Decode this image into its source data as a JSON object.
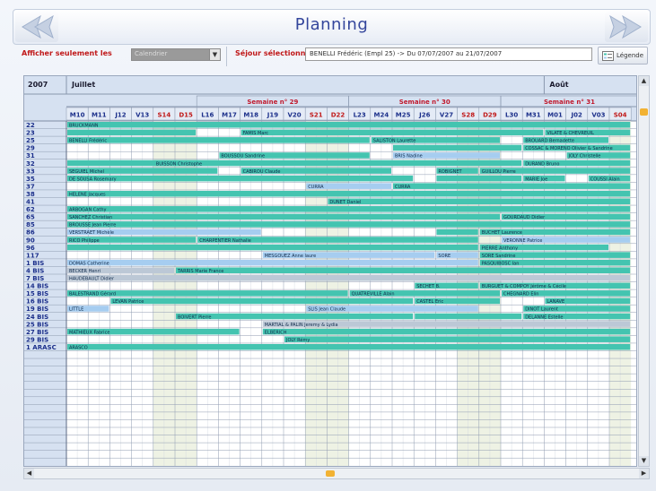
{
  "header": {
    "title": "Planning"
  },
  "filter": {
    "label": "Afficher seulement les",
    "value": "Calendrier"
  },
  "sejour": {
    "label": "Séjour sélectionné",
    "value": "BENELLI Frédéric (Empl 25) -> Du 07/07/2007 au 21/07/2007"
  },
  "legend_label": "Légende",
  "colors": {
    "teal": "#44c4b0",
    "blue": "#a6cdf0",
    "grey": "#bcc8d6",
    "header_bg": "#d6e1f1",
    "week_red": "#c0182c",
    "day_blue": "#1b2f8a",
    "weekend_red": "#c01818"
  },
  "planning": {
    "year": "2007",
    "months": [
      "Juillet",
      "Août"
    ],
    "weeks": [
      "Semaine n° 29",
      "Semaine n° 30",
      "Semaine n° 31"
    ],
    "days": [
      {
        "label": "M10",
        "weekend": false
      },
      {
        "label": "M11",
        "weekend": false
      },
      {
        "label": "J12",
        "weekend": false
      },
      {
        "label": "V13",
        "weekend": false
      },
      {
        "label": "S14",
        "weekend": true
      },
      {
        "label": "D15",
        "weekend": true
      },
      {
        "label": "L16",
        "weekend": false
      },
      {
        "label": "M17",
        "weekend": false
      },
      {
        "label": "M18",
        "weekend": false
      },
      {
        "label": "J19",
        "weekend": false
      },
      {
        "label": "V20",
        "weekend": false
      },
      {
        "label": "S21",
        "weekend": true
      },
      {
        "label": "D22",
        "weekend": true
      },
      {
        "label": "L23",
        "weekend": false
      },
      {
        "label": "M24",
        "weekend": false
      },
      {
        "label": "M25",
        "weekend": false
      },
      {
        "label": "J26",
        "weekend": false
      },
      {
        "label": "V27",
        "weekend": false
      },
      {
        "label": "S28",
        "weekend": true
      },
      {
        "label": "D29",
        "weekend": true
      },
      {
        "label": "L30",
        "weekend": false
      },
      {
        "label": "M31",
        "weekend": false
      },
      {
        "label": "M01",
        "weekend": false
      },
      {
        "label": "J02",
        "weekend": false
      },
      {
        "label": "V03",
        "weekend": false
      },
      {
        "label": "S04",
        "weekend": true
      }
    ],
    "rows": [
      {
        "label": "22",
        "bars": [
          {
            "s": 0,
            "e": 26,
            "c": "teal",
            "t": "BRUCKMANN"
          }
        ]
      },
      {
        "label": "23",
        "bars": [
          {
            "s": 0,
            "e": 6,
            "c": "teal",
            "t": ""
          },
          {
            "s": 8,
            "e": 22,
            "c": "teal",
            "t": "FAMIS Marc"
          },
          {
            "s": 22,
            "e": 26,
            "c": "teal",
            "t": "VILATE & CHEVREUIL"
          }
        ]
      },
      {
        "label": "25",
        "bars": [
          {
            "s": 0,
            "e": 14,
            "c": "teal",
            "t": "BENELLI Frédéric"
          },
          {
            "s": 14,
            "e": 20,
            "c": "teal",
            "t": "SALISTON Laurette"
          },
          {
            "s": 21,
            "e": 25,
            "c": "teal",
            "t": "BROUARD Bernadette"
          }
        ]
      },
      {
        "label": "29",
        "bars": [
          {
            "s": 15,
            "e": 21,
            "c": "teal",
            "t": ""
          },
          {
            "s": 21,
            "e": 26,
            "c": "teal",
            "t": "COSSAC & MORENO Olivier & Sandrine"
          }
        ]
      },
      {
        "label": "31",
        "bars": [
          {
            "s": 7,
            "e": 14,
            "c": "teal",
            "t": "BOUSSOU Sandrine"
          },
          {
            "s": 15,
            "e": 20,
            "c": "blue",
            "t": "BRIS Nadine"
          },
          {
            "s": 23,
            "e": 26,
            "c": "teal",
            "t": "JOLY Christelle"
          }
        ]
      },
      {
        "label": "32",
        "bars": [
          {
            "s": 0,
            "e": 7,
            "c": "teal",
            "t": ""
          },
          {
            "s": 4,
            "e": 21,
            "c": "teal",
            "t": "BUISSON Christophe"
          },
          {
            "s": 21,
            "e": 26,
            "c": "teal",
            "t": "DURAND Bruno"
          }
        ]
      },
      {
        "label": "33",
        "bars": [
          {
            "s": 0,
            "e": 7,
            "c": "teal",
            "t": "SEGUIEL Michel"
          },
          {
            "s": 8,
            "e": 15,
            "c": "teal",
            "t": "CABIROU Claude"
          },
          {
            "s": 17,
            "e": 19,
            "c": "teal",
            "t": "ROBIGNET"
          },
          {
            "s": 19,
            "e": 26,
            "c": "teal",
            "t": "GUILLOU Pierre"
          }
        ]
      },
      {
        "label": "35",
        "bars": [
          {
            "s": 0,
            "e": 16,
            "c": "teal",
            "t": "DE SOUSA Rosemary"
          },
          {
            "s": 17,
            "e": 21,
            "c": "teal",
            "t": ""
          },
          {
            "s": 21,
            "e": 23,
            "c": "teal",
            "t": "MARIE Joe"
          },
          {
            "s": 24,
            "e": 26,
            "c": "teal",
            "t": "COUSSI Alain"
          }
        ]
      },
      {
        "label": "37",
        "bars": [
          {
            "s": 11,
            "e": 15,
            "c": "blue",
            "t": "CURRA"
          },
          {
            "s": 15,
            "e": 26,
            "c": "teal",
            "t": "CURRA"
          }
        ]
      },
      {
        "label": "38",
        "bars": [
          {
            "s": 0,
            "e": 26,
            "c": "teal",
            "t": "HELENE Jacques"
          }
        ]
      },
      {
        "label": "41",
        "bars": [
          {
            "s": 12,
            "e": 26,
            "c": "teal",
            "t": "DUNET Daniel"
          }
        ]
      },
      {
        "label": "62",
        "bars": [
          {
            "s": 0,
            "e": 26,
            "c": "teal",
            "t": "ARBOGAN Cathy"
          }
        ]
      },
      {
        "label": "65",
        "bars": [
          {
            "s": 0,
            "e": 20,
            "c": "teal",
            "t": "SANCHEZ Christian"
          },
          {
            "s": 20,
            "e": 26,
            "c": "teal",
            "t": "GOURDAUD Didier"
          }
        ]
      },
      {
        "label": "85",
        "bars": [
          {
            "s": 0,
            "e": 26,
            "c": "teal",
            "t": "BROUSSE Jean Pierre"
          }
        ]
      },
      {
        "label": "86",
        "bars": [
          {
            "s": 0,
            "e": 9,
            "c": "blue",
            "t": "VERSTRAET Michèle"
          },
          {
            "s": 17,
            "e": 19,
            "c": "teal",
            "t": ""
          },
          {
            "s": 19,
            "e": 26,
            "c": "teal",
            "t": "BUCHET Laurence"
          }
        ]
      },
      {
        "label": "90",
        "bars": [
          {
            "s": 0,
            "e": 6,
            "c": "teal",
            "t": "RICO Philippe"
          },
          {
            "s": 6,
            "e": 19,
            "c": "teal",
            "t": "CHARPENTIER Nathalie"
          },
          {
            "s": 20,
            "e": 26,
            "c": "blue",
            "t": "VERONNE Patrice"
          }
        ]
      },
      {
        "label": "96",
        "bars": [
          {
            "s": 0,
            "e": 19,
            "c": "teal",
            "t": ""
          },
          {
            "s": 19,
            "e": 25,
            "c": "teal",
            "t": "PIERRE Anthony"
          }
        ]
      },
      {
        "label": "117",
        "bars": [
          {
            "s": 9,
            "e": 17,
            "c": "blue",
            "t": "MESGOUEZ Anne laure"
          },
          {
            "s": 17,
            "e": 19,
            "c": "blue",
            "t": "SORE"
          },
          {
            "s": 19,
            "e": 26,
            "c": "teal",
            "t": "SORE Sandrine"
          }
        ]
      },
      {
        "label": "1 BIS",
        "bars": [
          {
            "s": 0,
            "e": 19,
            "c": "blue",
            "t": "DOMAS Catherine"
          },
          {
            "s": 19,
            "e": 26,
            "c": "teal",
            "t": "PASQUIBOSC Ian"
          }
        ]
      },
      {
        "label": "4 BIS",
        "bars": [
          {
            "s": 0,
            "e": 5,
            "c": "grey",
            "t": "BECKER Henri"
          },
          {
            "s": 5,
            "e": 26,
            "c": "teal",
            "t": "TARRIS Marie France"
          }
        ]
      },
      {
        "label": "7 BIS",
        "bars": [
          {
            "s": 0,
            "e": 26,
            "c": "grey",
            "t": "HAUDEBAULT Didier"
          }
        ]
      },
      {
        "label": "14 BIS",
        "bars": [
          {
            "s": 16,
            "e": 19,
            "c": "teal",
            "t": "SECHET B."
          },
          {
            "s": 19,
            "e": 26,
            "c": "teal",
            "t": "BURGUET & COMPOY Jérôme & Cécile"
          }
        ]
      },
      {
        "label": "15 BIS",
        "bars": [
          {
            "s": 0,
            "e": 13,
            "c": "teal",
            "t": "BALESTRAND Gérard"
          },
          {
            "s": 13,
            "e": 20,
            "c": "teal",
            "t": "QUATREVILLE Alain"
          },
          {
            "s": 20,
            "e": 26,
            "c": "teal",
            "t": "CHEGNARD Elin"
          }
        ]
      },
      {
        "label": "16 BIS",
        "bars": [
          {
            "s": 2,
            "e": 16,
            "c": "teal",
            "t": "LEVAN Patrice"
          },
          {
            "s": 16,
            "e": 20,
            "c": "teal",
            "t": "CASTEL Eric"
          },
          {
            "s": 22,
            "e": 26,
            "c": "teal",
            "t": "LANAVE"
          }
        ]
      },
      {
        "label": "19 BIS",
        "bars": [
          {
            "s": 0,
            "e": 2,
            "c": "blue",
            "t": "LITTLE"
          },
          {
            "s": 11,
            "e": 19,
            "c": "blue",
            "t": "SLIS Jean Claude"
          },
          {
            "s": 21,
            "e": 26,
            "c": "teal",
            "t": "DINOT Laurent"
          }
        ]
      },
      {
        "label": "24 BIS",
        "bars": [
          {
            "s": 5,
            "e": 16,
            "c": "teal",
            "t": "BOIVERT Pierre"
          },
          {
            "s": 16,
            "e": 21,
            "c": "teal",
            "t": ""
          },
          {
            "s": 21,
            "e": 26,
            "c": "teal",
            "t": "DELANNE Estelle"
          }
        ]
      },
      {
        "label": "25 BIS",
        "bars": [
          {
            "s": 9,
            "e": 26,
            "c": "grey",
            "t": "MARTIAL & PALIN Jeremy & Lydia"
          }
        ]
      },
      {
        "label": "27 BIS",
        "bars": [
          {
            "s": 0,
            "e": 8,
            "c": "teal",
            "t": "MATHIEUX Fabrice"
          },
          {
            "s": 9,
            "e": 26,
            "c": "teal",
            "t": "ELBERICH"
          }
        ]
      },
      {
        "label": "29 BIS",
        "bars": [
          {
            "s": 10,
            "e": 26,
            "c": "teal",
            "t": "JOLY Rémy"
          }
        ]
      },
      {
        "label": "1 ARASC",
        "bars": [
          {
            "s": 0,
            "e": 26,
            "c": "teal",
            "t": "ARASCO"
          }
        ]
      }
    ],
    "empty_rows": 14
  }
}
